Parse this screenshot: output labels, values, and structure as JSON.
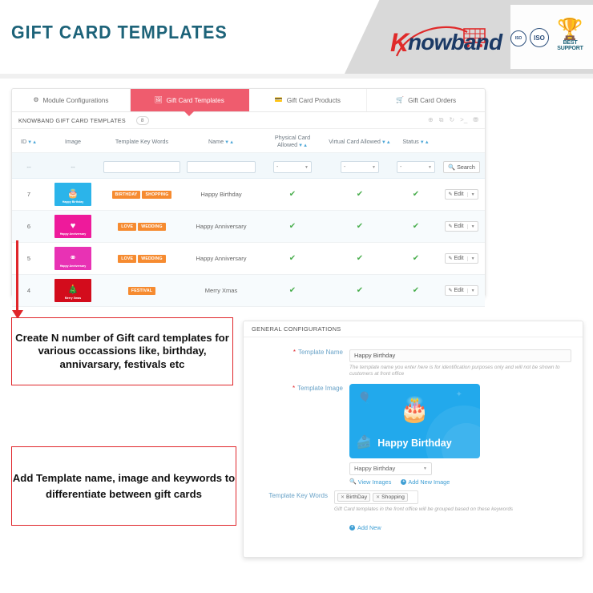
{
  "header": {
    "title": "GIFT CARD TEMPLATES",
    "logo": {
      "k": "K",
      "text": "nowband"
    },
    "badges": {
      "seal1": "ISO",
      "seal2": "ISO",
      "best_support_label": "BEST SUPPORT",
      "wreath_icon": "trophy-wreath-icon"
    }
  },
  "tabs": [
    {
      "label": "Module Configurations",
      "icon": "gear-icon",
      "active": false
    },
    {
      "label": "Gift Card Templates",
      "icon": "image-icon",
      "active": true
    },
    {
      "label": "Gift Card Products",
      "icon": "card-icon",
      "active": false
    },
    {
      "label": "Gift Card Orders",
      "icon": "cart-icon",
      "active": false
    }
  ],
  "panel": {
    "title": "KNOWBAND GIFT CARD TEMPLATES",
    "count": "8",
    "tools": [
      {
        "name": "add-icon",
        "glyph": "⊕"
      },
      {
        "name": "export-icon",
        "glyph": "⧉"
      },
      {
        "name": "refresh-icon",
        "glyph": "↻"
      },
      {
        "name": "console-icon",
        "glyph": ">_"
      },
      {
        "name": "database-icon",
        "glyph": "⛃"
      }
    ]
  },
  "table": {
    "columns": [
      {
        "label": "ID",
        "sortable": true
      },
      {
        "label": "Image",
        "sortable": false
      },
      {
        "label": "Template Key Words",
        "sortable": false
      },
      {
        "label": "Name",
        "sortable": true
      },
      {
        "label": "Physical Card Allowed",
        "sortable": true
      },
      {
        "label": "Virtual Card Allowed",
        "sortable": true
      },
      {
        "label": "Status",
        "sortable": true
      },
      {
        "label": "",
        "sortable": false
      }
    ],
    "filters": {
      "id": "--",
      "image": "--",
      "keywords_value": "",
      "name_value": "",
      "physical_select": "-",
      "virtual_select": "-",
      "status_select": "-",
      "search_label": "Search"
    },
    "rows": [
      {
        "id": "7",
        "thumb": {
          "label": "Happy Birthday",
          "color": "#2bb4ea",
          "glyph": "🎂",
          "icon": "cake-icon"
        },
        "tags": [
          "BIRTHDAY",
          "SHOPPING"
        ],
        "name": "Happy Birthday",
        "physical": "✔",
        "virtual": "✔",
        "status": "✔",
        "action": "Edit"
      },
      {
        "id": "6",
        "thumb": {
          "label": "Happy Anniversary",
          "color": "#ee1a9b",
          "glyph": "♥",
          "icon": "hearts-icon"
        },
        "tags": [
          "LOVE",
          "WEDDING"
        ],
        "name": "Happy Anniversary",
        "physical": "✔",
        "virtual": "✔",
        "status": "✔",
        "action": "Edit"
      },
      {
        "id": "5",
        "thumb": {
          "label": "Happy Anniversary",
          "color": "#e832b4",
          "glyph": "⚭",
          "icon": "rings-icon"
        },
        "tags": [
          "LOVE",
          "WEDDING"
        ],
        "name": "Happy Anniversary",
        "physical": "✔",
        "virtual": "✔",
        "status": "✔",
        "action": "Edit"
      },
      {
        "id": "4",
        "thumb": {
          "label": "Merry Xmas",
          "color": "#d30c1c",
          "glyph": "🎄",
          "icon": "christmas-tree-icon"
        },
        "tags": [
          "FESTIVAL"
        ],
        "name": "Merry Xmas",
        "physical": "✔",
        "virtual": "✔",
        "status": "✔",
        "action": "Edit"
      }
    ]
  },
  "annotations": {
    "box1": "Create N number of Gift card templates for various occassions like, birthday, annivarsary, festivals etc",
    "box2": "Add Template name, image and keywords to differentiate between gift cards",
    "arrow_down_icon": "red-down-arrow-icon",
    "arrow_left_icon": "red-left-arrow-icon",
    "border_color": "#e0262b"
  },
  "config": {
    "header_title": "GENERAL CONFIGURATIONS",
    "template_name": {
      "label": "Template Name",
      "value": "Happy Birthday",
      "placeholder": "Template Name",
      "hint": "The template name you enter here is for identification purposes only and will not be shown to customers at front office"
    },
    "template_image": {
      "label": "Template Image",
      "preview_title": "Happy Birthday",
      "preview_color": "#22a9ec",
      "select_value": "Happy Birthday",
      "view_images_label": "View Images",
      "add_new_image_label": "Add New Image"
    },
    "keywords": {
      "label": "Template Key Words",
      "chips": [
        "BirthDay",
        "Shopping"
      ],
      "hint": "Gift Card templates in the front office will be grouped based on these keywords",
      "add_new_label": "Add New"
    }
  }
}
